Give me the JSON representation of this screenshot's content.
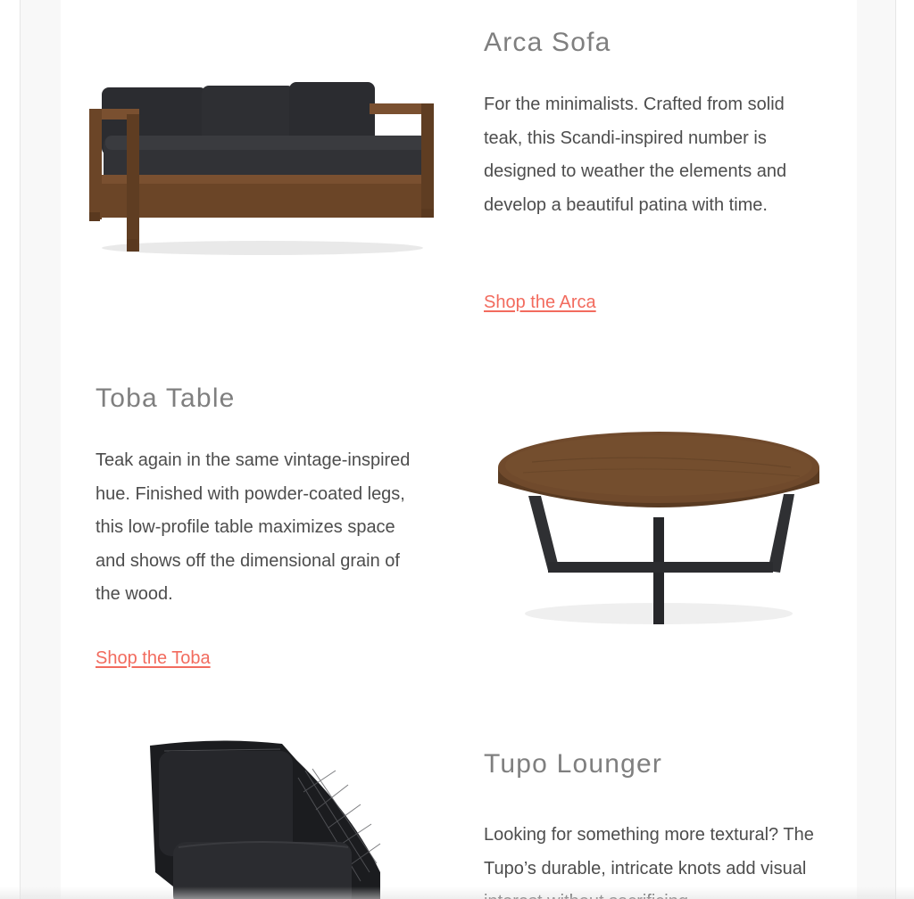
{
  "products": [
    {
      "title": "Arca Sofa",
      "description": "For the minimalists. Crafted from solid teak, this Scandi-inspired number is designed to weather the elements and develop a beautiful patina with time.",
      "link": "Shop the Arca",
      "image_icon": "sofa-image"
    },
    {
      "title": "Toba Table",
      "description": "Teak again in the same vintage-inspired hue. Finished with powder-coated legs, this low-profile table maximizes space and shows off the dimensional grain of the wood.",
      "link": "Shop the Toba",
      "image_icon": "coffee-table-image"
    },
    {
      "title": "Tupo Lounger",
      "description": "Looking for something more textural? The Tupo’s durable, intricate knots add visual interest without sacrificing",
      "link": "",
      "image_icon": "lounge-chair-image"
    }
  ],
  "colors": {
    "title": "#7f7f7f",
    "body_text": "#4d4d4d",
    "link": "#f26b5e",
    "page_background": "#f8f8f8",
    "card_background": "#ffffff"
  }
}
